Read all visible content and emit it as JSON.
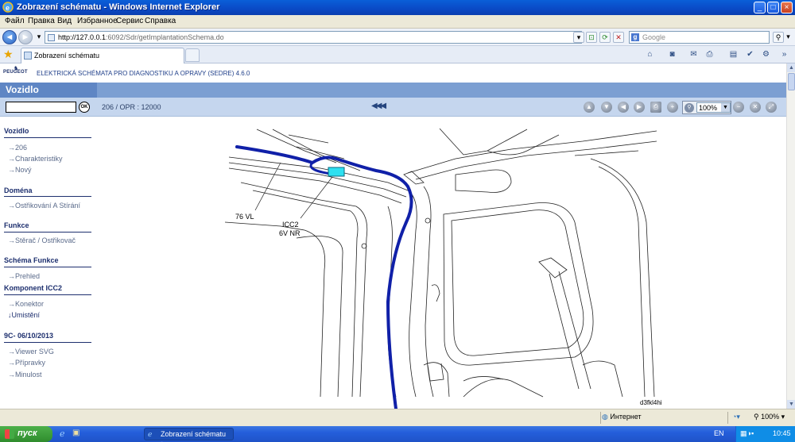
{
  "window": {
    "title": "Zobrazení schématu - Windows Internet Explorer"
  },
  "menu": [
    "Файл",
    "Правка",
    "Вид",
    "Избранное",
    "Сервис",
    "Справка"
  ],
  "address": {
    "host": "http://127.0.0.1",
    "path": ":6092/Sdr/getImplantationSchema.do"
  },
  "search": {
    "placeholder": "Google"
  },
  "tab": {
    "title": "Zobrazení schématu"
  },
  "app": {
    "logo_text": "PEUGEOT",
    "title": "ELEKTRICKÁ SCHÉMATA PRO DIAGNOSTIKU A OPRAVY (SEDRE) 4.6.0",
    "section_tab": "Vozidlo",
    "ok_label": "OK",
    "breadcrumb": "206  /  OPR : 12000",
    "zoom": "100%"
  },
  "sidebar": {
    "sections": [
      {
        "title": "Vozidlo",
        "items": [
          "206",
          "Charakteristiky",
          "Nový"
        ]
      },
      {
        "title": "Doména",
        "items": [
          "Ostřikování A Stírání"
        ]
      },
      {
        "title": "Funkce",
        "items": [
          "Stěrač / Ostřikovač"
        ]
      },
      {
        "title": "Schéma Funkce",
        "items": [
          "Prehled"
        ]
      },
      {
        "title": "Komponent ICC2",
        "items": [
          "Konektor",
          "Umistění"
        ]
      },
      {
        "title": "9C- 06/10/2013",
        "items": [
          "Viewer SVG",
          "Přípravky",
          "Minulost"
        ]
      }
    ]
  },
  "diagram": {
    "label_wire": "76 VL",
    "label_component_1": "ICC2",
    "label_component_2": "6V NR",
    "label_code": "d3fkl4hi",
    "wire_color": "#1020a8",
    "connector_color": "#2ee0f0"
  },
  "status": {
    "zone": "Интернет",
    "zoom": "100%"
  },
  "taskbar": {
    "start": "пуск",
    "item": "Zobrazení schématu -...",
    "lang": "EN",
    "clock": "10:45"
  }
}
